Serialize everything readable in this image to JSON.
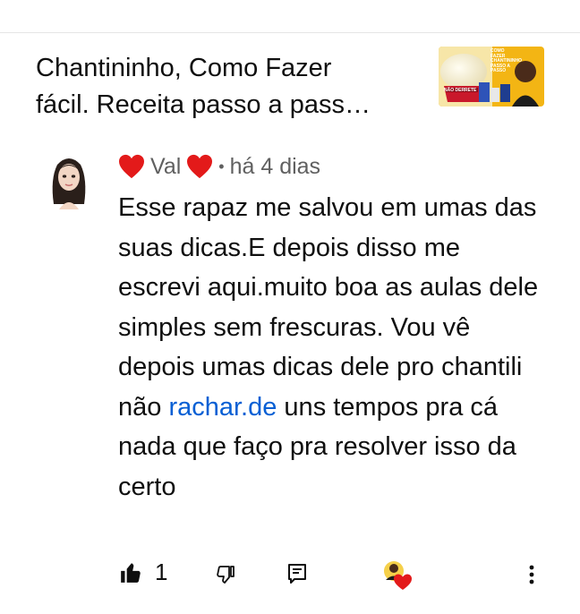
{
  "video": {
    "title": "Chantininho, Como Fazer\nfácil. Receita passo a pass…",
    "thumbnail": {
      "overlay_text": "COMO FAZER CHANTININHO PASSO A PASSO",
      "product_text": "NÃO DERRETE",
      "accent_color": "#f5b400"
    }
  },
  "comment": {
    "author": "Val",
    "author_decoration": "heart",
    "separator": "•",
    "timestamp": "há 4 dias",
    "text_main": "Esse rapaz me salvou em umas das suas dicas.E depois disso me escrevi aqui.muito boa as aulas dele simples sem frescuras. Vou vê depois umas dicas dele pro chantili não ",
    "link_text": "rachar.de",
    "text_after": " uns tempos pra cá nada que faço pra resolver isso da certo",
    "like_count": "1"
  },
  "actions": {
    "like_icon": "thumbs-up-icon",
    "dislike_icon": "thumbs-down-icon",
    "reply_icon": "reply-icon",
    "creator_heart_icon": "creator-heart-icon",
    "more_icon": "more-vertical-icon"
  },
  "colors": {
    "text_primary": "#0f0f0f",
    "text_secondary": "#606060",
    "link": "#065fd4",
    "heart": "#e31a1a"
  }
}
